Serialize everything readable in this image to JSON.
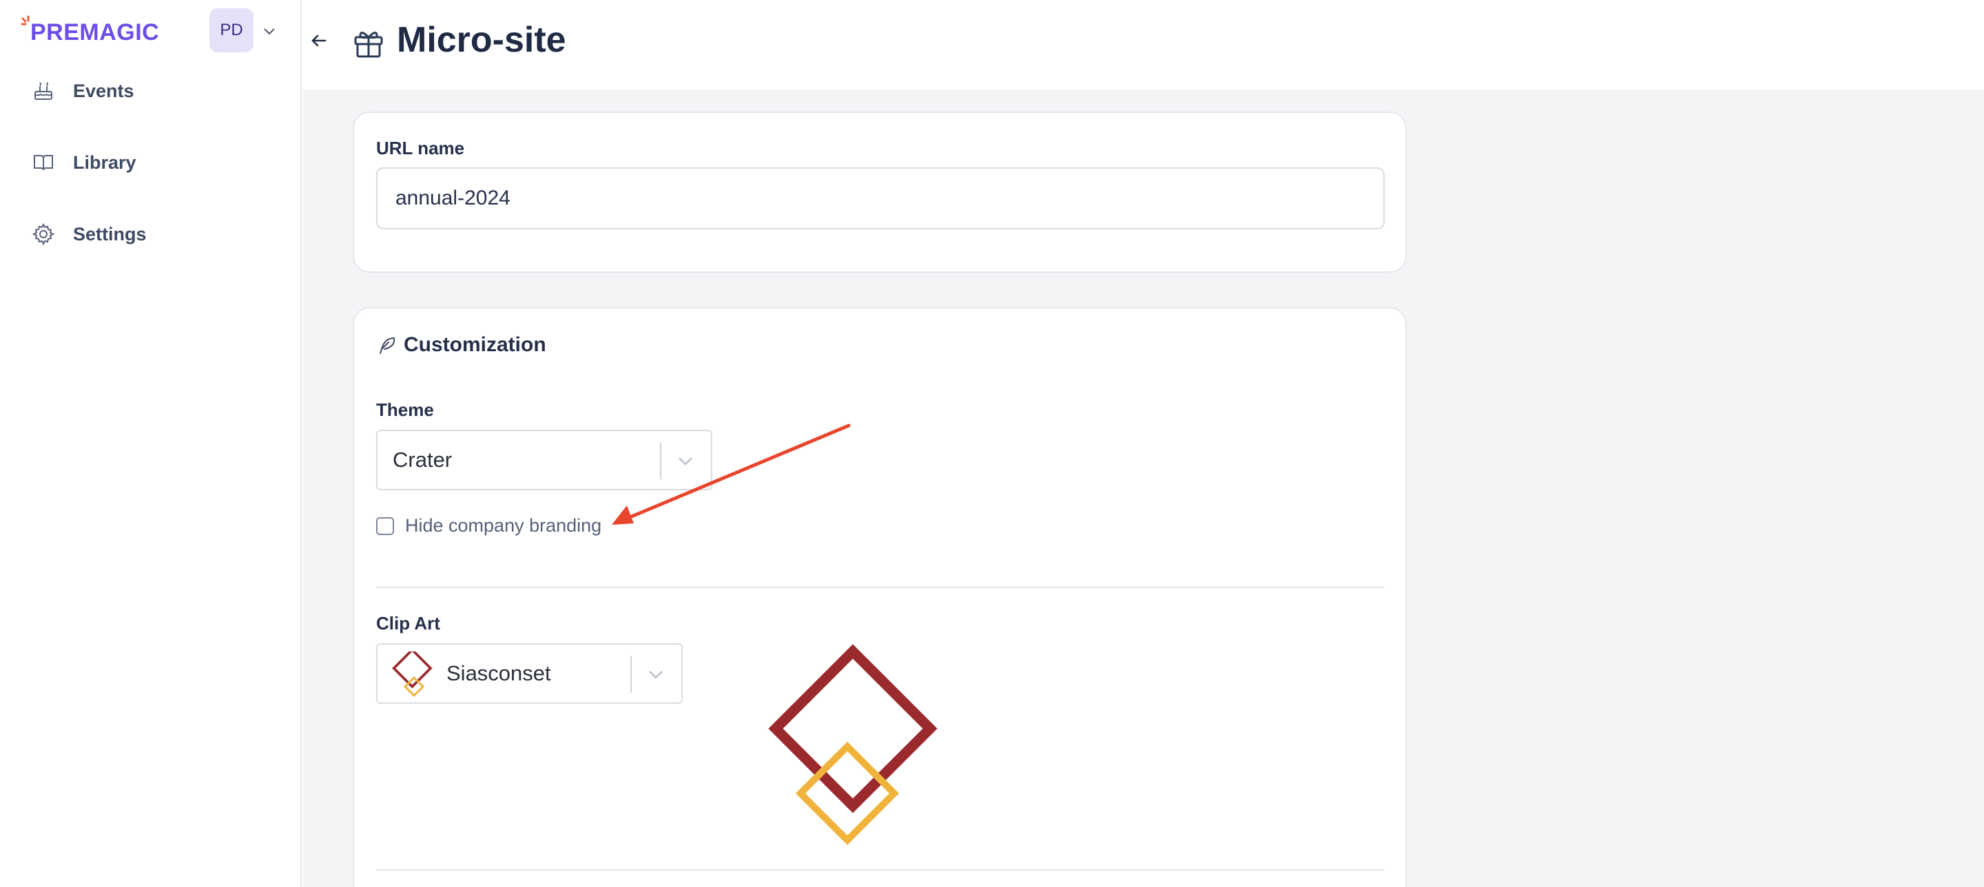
{
  "app": {
    "logo_text": "PREMAGIC",
    "avatar_initials": "PD",
    "brand_color": "#6d4de8"
  },
  "sidebar": {
    "items": [
      {
        "label": "Events",
        "icon": "cake-icon"
      },
      {
        "label": "Library",
        "icon": "book-icon"
      },
      {
        "label": "Settings",
        "icon": "gear-icon"
      }
    ]
  },
  "header": {
    "title": "Micro-site",
    "icon": "gift-icon",
    "back_icon": "arrow-left-icon"
  },
  "url_card": {
    "label": "URL name",
    "value": "annual-2024"
  },
  "customization": {
    "title": "Customization",
    "icon": "feather-icon",
    "theme": {
      "label": "Theme",
      "value": "Crater"
    },
    "hide_branding": {
      "label": "Hide company branding",
      "checked": false
    },
    "clip_art": {
      "label": "Clip Art",
      "value": "Siasconset"
    }
  },
  "colors": {
    "clip_art_primary": "#9b2a2e",
    "clip_art_secondary": "#f0b43c",
    "annotation_arrow": "#e8452c"
  }
}
